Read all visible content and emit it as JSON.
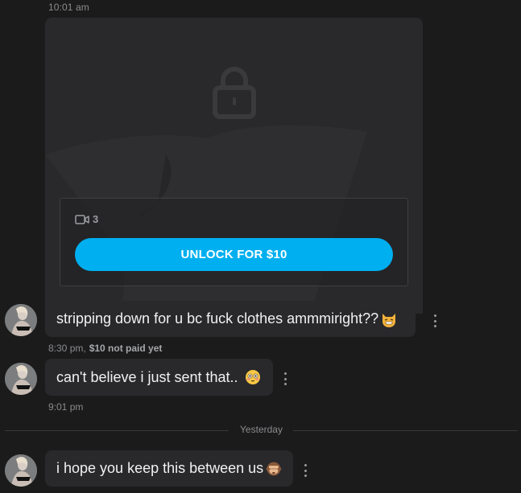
{
  "messages": [
    {
      "time_top": "10:01 am",
      "locked_media": {
        "count": "3",
        "unlock_label": "UNLOCK FOR $10"
      },
      "text": "stripping down for u bc fuck clothes ammmiright??",
      "emoji": "cat-face-emoji",
      "meta_time": "8:30 pm,",
      "meta_price": "$10 not paid yet"
    },
    {
      "text": "can't believe i just sent that..",
      "emoji": "flushed-face-emoji",
      "meta_time": "9:01 pm"
    },
    {
      "text": "i hope you keep this between us",
      "emoji": "see-no-evil-monkey-emoji"
    }
  ],
  "divider_label": "Yesterday",
  "colors": {
    "background": "#1b1b1c",
    "bubble": "#29292b",
    "accent": "#00aff0",
    "muted_text": "#8a8b8d"
  },
  "icons": [
    "lock-icon",
    "video-icon",
    "more-vertical-icon"
  ]
}
